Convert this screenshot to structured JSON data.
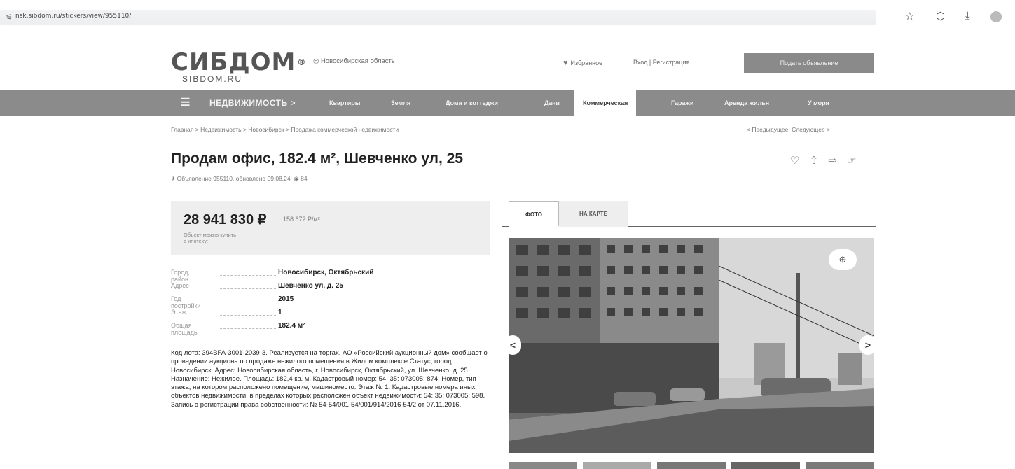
{
  "browser": {
    "url": "nsk.sibdom.ru/stickers/view/955110/",
    "icons": [
      "tune-icon",
      "star-icon",
      "extensions-icon",
      "download-icon",
      "profile-icon"
    ]
  },
  "header": {
    "logo": "СИБДОМ",
    "logo_reg": "®",
    "logo_sub": "SIBDOM.RU",
    "region": "Новосибирская область",
    "favorites": "Избранное",
    "login": "Вход",
    "separator": "|",
    "register": "Регистрация",
    "post_ad": "Подать объявление"
  },
  "nav": {
    "title": "НЕДВИЖИМОСТЬ >",
    "items": [
      "Квартиры",
      "Земля",
      "Дома и коттеджи",
      "Дачи",
      "Коммерческая",
      "Гаражи",
      "Аренда жилья",
      "У моря"
    ],
    "active": "Коммерческая"
  },
  "breadcrumb": {
    "items": [
      "Главная",
      "Недвижимость",
      "Новосибирск",
      "Продажа коммерческой недвижимости"
    ],
    "sep": ">",
    "prev": "< Предыдущее",
    "next": "Следующее >"
  },
  "listing": {
    "title": "Продам офис, 182.4 м², Шевченко ул, 25",
    "meta": "Объявление 955110, обновлено 09.08.24",
    "views": "84",
    "price": "28 941 830 ₽",
    "price_per": "158 672 Р/м²",
    "mortgage": "Объект можно купить в ипотеку:"
  },
  "props": [
    {
      "key": "Город, район",
      "value": "Новосибирск, Октябрьский"
    },
    {
      "key": "Адрес",
      "value": "Шевченко ул, д. 25"
    },
    {
      "key": "Год постройки",
      "value": "2015"
    },
    {
      "key": "Этаж",
      "value": "1"
    },
    {
      "key": "Общая площадь",
      "value": "182.4 м²"
    }
  ],
  "description": "Код лота: 394BFA-3001-2039-3. Реализуется на торгах. АО «Российский аукционный дом» сообщает о проведении аукциона по продаже нежилого помещения в Жилом комплексе Статус, город Новосибирск. Адрес: Новосибирская область, г. Новосибирск, Октябрьский, ул. Шевченко, д. 25. Назначение: Нежилое. Площадь: 182,4 кв. м. Кадастровый номер: 54: 35: 073005: 874. Номер, тип этажа, на котором расположено помещение, машиноместо: Этаж № 1. Кадастровые номера иных объектов недвижимости, в пределах которых расположен объект недвижимости: 54: 35: 073005: 598. Запись о регистрации права собственности: № 54-54/001-54/001/914/2016-54/2 от 07.11.2016.",
  "gallery": {
    "tab_photo": "ФОТО",
    "tab_map": "НА КАРТЕ",
    "prev": "<",
    "next": ">",
    "zoom": "⊕"
  }
}
